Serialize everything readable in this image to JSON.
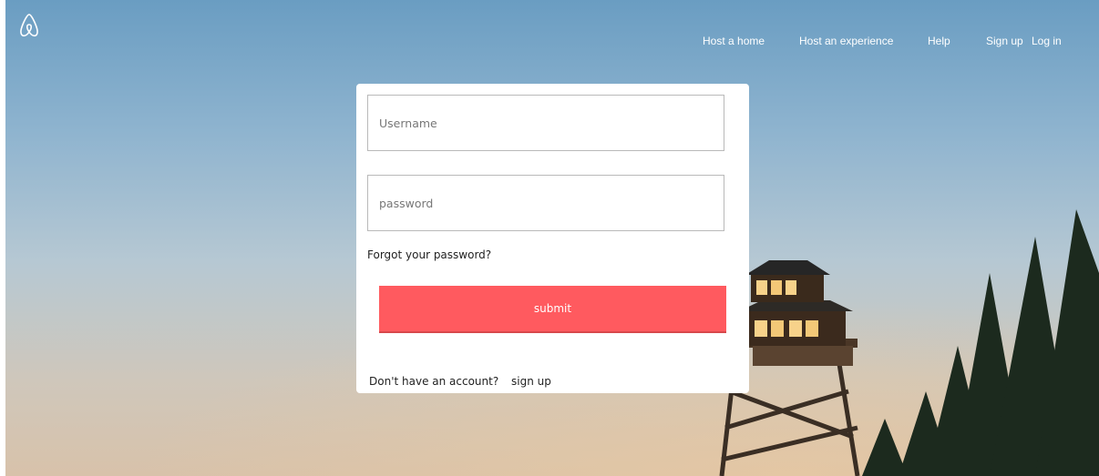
{
  "brand": {
    "logo_icon": "airbnb-belo-icon"
  },
  "nav": {
    "items": [
      {
        "label": "Host a home"
      },
      {
        "label": "Host an experience"
      },
      {
        "label": "Help"
      },
      {
        "label": "Sign up"
      },
      {
        "label": "Log in"
      }
    ]
  },
  "login": {
    "username_placeholder": "Username",
    "password_placeholder": "password",
    "forgot_label": "Forgot your password?",
    "submit_label": "submit",
    "no_account_text": "Don't have an account?",
    "signup_link": "sign up"
  },
  "colors": {
    "accent": "#ff5a5f",
    "nav_text": "#ffffff"
  }
}
